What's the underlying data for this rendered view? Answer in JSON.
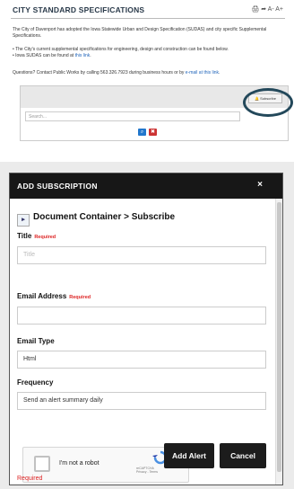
{
  "page": {
    "title": "CITY STANDARD SPECIFICATIONS",
    "tools": "🖨 ➦  A-  A+",
    "intro": "The City of Davenport has adopted the Iowa Statewide Urban and Design Specification (SUDAS) and city specific Supplemental Specifications.",
    "bullet_1": "The City's current supplemental specifications for engineering, design and construction can be found below.",
    "bullet_2_prefix": "Iowa SUDAS can be found at ",
    "bullet_2_link": "this link",
    "questions_prefix": "Questions? Contact Public Works by calling 563.326.7923 during business hours or by ",
    "questions_link": "e-mail at this link",
    "subscribe_label": "🔔 Subscribe",
    "search_placeholder": "Search...",
    "search_btn": "⌕",
    "clear_btn": "✖"
  },
  "modal": {
    "title": "ADD SUBSCRIPTION",
    "close": "×",
    "breadcrumb": "Document Container > Subscribe",
    "title_label": "Title",
    "required_tag": "Required",
    "title_placeholder": "Title",
    "email_label": "Email Address",
    "email_value": "",
    "email_type_label": "Email Type",
    "email_type_value": "Html",
    "frequency_label": "Frequency",
    "frequency_value": "Send an alert summary daily",
    "captcha_text": "I'm not a robot",
    "captcha_brand": "reCAPTCHA",
    "captcha_privacy": "Privacy - Terms",
    "add_alert": "Add Alert",
    "cancel": "Cancel",
    "required_note": "Required"
  },
  "colors": {
    "header_dark": "#171717",
    "required_red": "#dd2222",
    "link_blue": "#2266bb",
    "highlight_circle": "#23485a"
  }
}
